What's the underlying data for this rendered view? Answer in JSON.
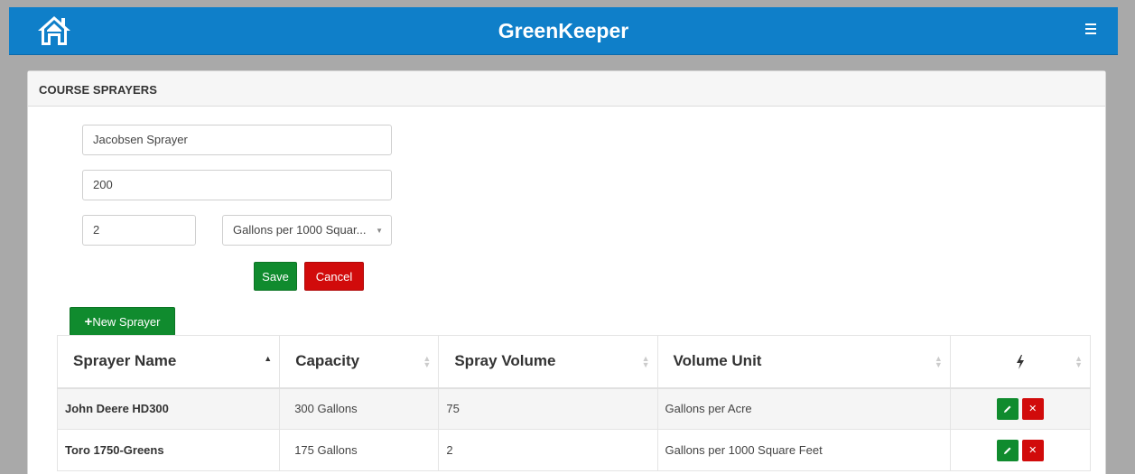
{
  "header": {
    "title": "GreenKeeper",
    "home_icon": "home-icon",
    "menu_icon": "hamburger-menu-icon",
    "bg_color": "#0f7fc9"
  },
  "panel": {
    "heading": "COURSE SPRAYERS"
  },
  "form": {
    "name_value": "Jacobsen Sprayer",
    "capacity_value": "200",
    "spray_volume_value": "2",
    "volume_unit_selected": "Gallons per 1000 Squar...",
    "save_label": "Save",
    "cancel_label": "Cancel"
  },
  "new_sprayer_label": "New Sprayer",
  "table": {
    "columns": [
      "Sprayer Name",
      "Capacity",
      "Spray Volume",
      "Volume Unit"
    ],
    "actions_icon": "lightning-bolt-icon",
    "rows": [
      {
        "name": "John Deere HD300",
        "capacity": "300 Gallons",
        "spray_volume": "75",
        "volume_unit": "Gallons per Acre"
      },
      {
        "name": "Toro 1750-Greens",
        "capacity": "175 Gallons",
        "spray_volume": "2",
        "volume_unit": "Gallons per 1000 Square Feet"
      }
    ]
  },
  "colors": {
    "accent_green": "#108b2e",
    "accent_red": "#d10b0b"
  }
}
